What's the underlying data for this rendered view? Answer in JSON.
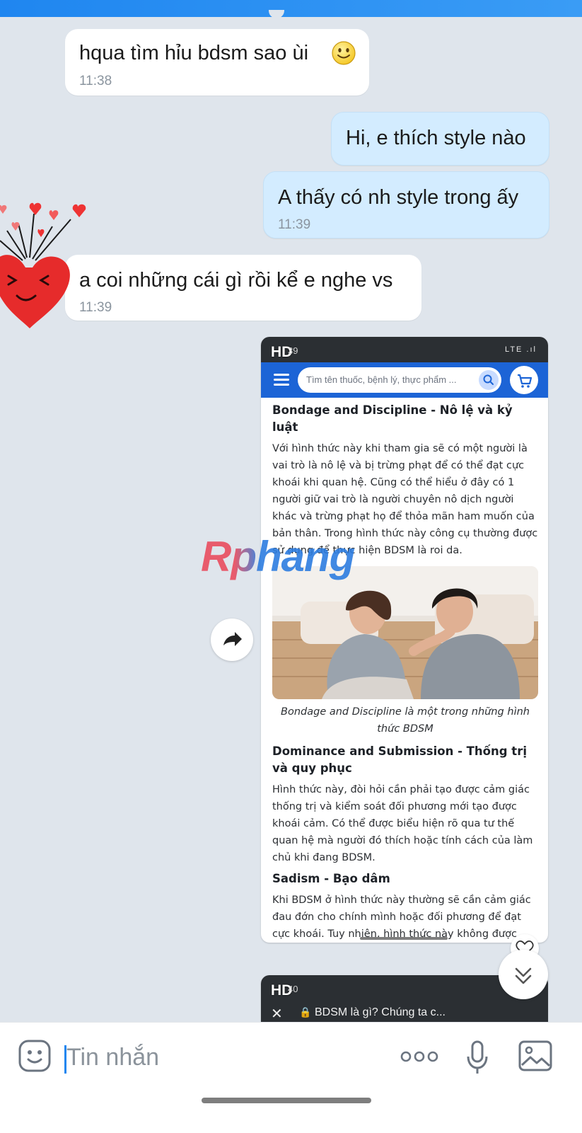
{
  "messages": [
    {
      "text": "hqua tìm hỉu bdsm sao ùi",
      "time": "11:38",
      "emoji": "slightly-smiling-face-emoji"
    },
    {
      "text": "Hi, e thích style nào"
    },
    {
      "text": "A thấy có nh style trong ấy",
      "time": "11:39"
    },
    {
      "text": "a coi những cái gì rồi kể e nghe vs",
      "time": "11:39"
    }
  ],
  "screenshot1": {
    "hd_label": "HD",
    "status_time_fragment": "39",
    "status_icons": "LTE .ıl",
    "search_placeholder": "Tìm tên thuốc, bệnh lý, thực phẩm ...",
    "section1_title": "Bondage and Discipline - Nô lệ và kỷ luật",
    "section1_text": "Với hình thức này khi tham gia sẽ có một người là vai trò là nô lệ và bị trừng phạt để có thể đạt cực khoái khi quan hệ. Cũng có thể hiểu ở đây có 1 người giữ vai trò là người chuyên nô dịch người khác và trừng phạt họ để thỏa mãn ham muốn của bản thân. Trong hình thức này công cụ thường được sử dụng để thực hiện BDSM là roi da.",
    "image_caption": "Bondage and Discipline là một trong những hình thức BDSM",
    "section2_title": "Dominance and Submission - Thống trị và quy phục",
    "section2_text": "Hình thức này, đòi hỏi cần phải tạo được cảm giác thống trị và kiểm soát đối phương mới tạo được khoái cảm. Có thể được biểu hiện rõ qua tư thế quan hệ mà người đó thích hoặc tính cách của làm chủ khi đang BDSM.",
    "section3_title": "Sadism - Bạo dâm",
    "section3_text": "Khi BDSM ở hình thức này thường sẽ cần cảm giác đau đớn cho chính mình hoặc đối phương để đạt cực khoái. Tuy nhiên, hình thức này không được"
  },
  "watermark": "Rphang",
  "screenshot2": {
    "hd_label": "HD",
    "status_time_fragment": "40",
    "page_title": "BDSM là gì? Chúng ta c..."
  },
  "composer": {
    "placeholder": "Tin nhắn"
  },
  "colors": {
    "accent": "#1f86f0",
    "out_bubble": "#d3ecff",
    "in_bubble": "#ffffff",
    "app_blue": "#1c64d6"
  }
}
